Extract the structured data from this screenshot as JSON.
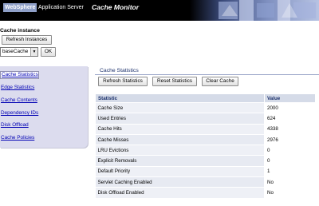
{
  "banner": {
    "brand_bold": "WebSphere",
    "brand_rest": "Application Server",
    "title": "Cache Monitor"
  },
  "instance": {
    "title": "Cache instance",
    "refresh_label": "Refresh Instances",
    "selected": "baseCache",
    "ok_label": "OK"
  },
  "nav": {
    "items": [
      {
        "label": "Cache Statistics",
        "active": true
      },
      {
        "label": "Edge Statistics"
      },
      {
        "label": "Cache Contents"
      },
      {
        "label": "Dependency IDs"
      },
      {
        "label": "Disk Offload"
      },
      {
        "label": "Cache Policies"
      }
    ]
  },
  "main": {
    "section_title": "Cache Statistics",
    "buttons": {
      "refresh": "Refresh Statistics",
      "reset": "Reset Statistics",
      "clear": "Clear Cache"
    },
    "table": {
      "headers": [
        "Statistic",
        "Value"
      ],
      "rows": [
        [
          "Cache Size",
          "2000"
        ],
        [
          "Used Entries",
          "624"
        ],
        [
          "Cache Hits",
          "4338"
        ],
        [
          "Cache Misses",
          "2976"
        ],
        [
          "LRU Evictions",
          "0"
        ],
        [
          "Explicit Removals",
          "0"
        ],
        [
          "Default Priority",
          "1"
        ],
        [
          "Servlet Caching Enabled",
          "No"
        ],
        [
          "Disk Offload Enabled",
          "No"
        ]
      ]
    }
  },
  "colors": {
    "banner_bg": "#000000",
    "nav_bg": "#dcdcee",
    "link": "#0000b4",
    "header_bg": "#d5dbe8",
    "title_text": "#1a2f6b"
  }
}
